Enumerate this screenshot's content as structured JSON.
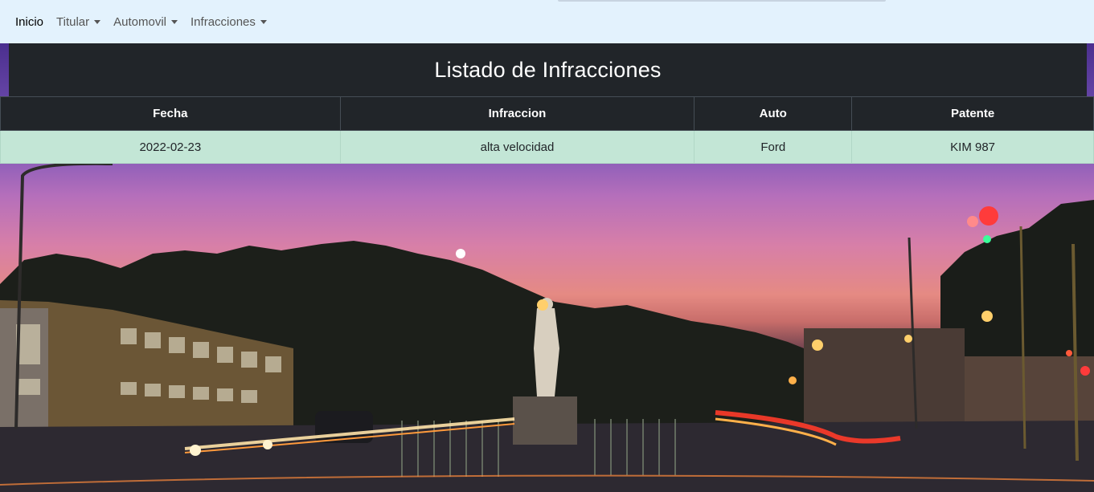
{
  "nav": {
    "brand": "Inicio",
    "items": [
      {
        "label": "Titular"
      },
      {
        "label": "Automovil"
      },
      {
        "label": "Infracciones"
      }
    ]
  },
  "page": {
    "title": "Listado de Infracciones"
  },
  "table": {
    "headers": [
      "Fecha",
      "Infraccion",
      "Auto",
      "Patente"
    ],
    "rows": [
      [
        "2022-02-23",
        "alta velocidad",
        "Ford",
        "KIM 987"
      ]
    ]
  },
  "colors": {
    "navbar_bg": "#e3f2fd",
    "dark": "#212529",
    "row_success": "#c3e6d6"
  }
}
